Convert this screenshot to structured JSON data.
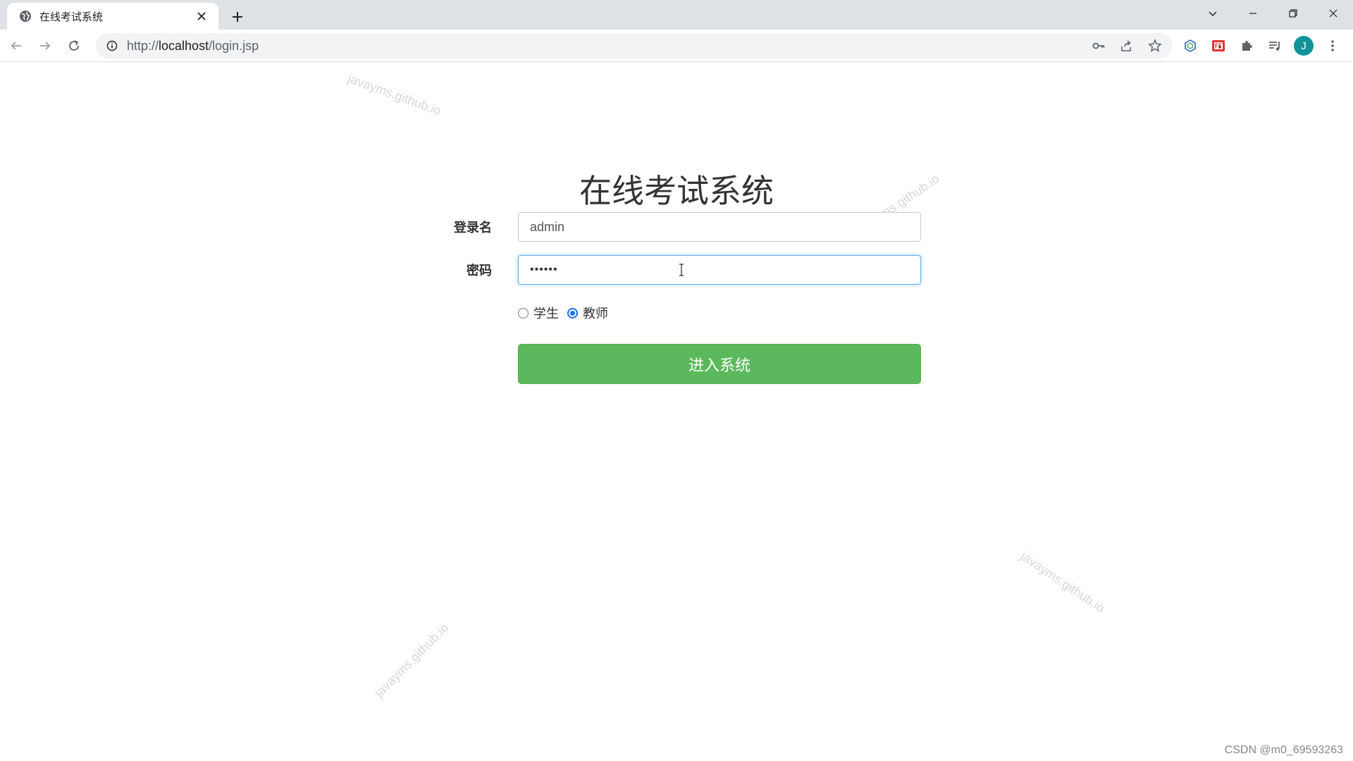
{
  "browser": {
    "tab_title": "在线考试系统",
    "url_scheme": "http://",
    "url_host": "localhost",
    "url_path": "/login.jsp",
    "avatar_letter": "J",
    "accent": "#1a73e8"
  },
  "page": {
    "watermark_text": "javayms.github.io",
    "title": "在线考试系统",
    "username_label": "登录名",
    "username_value": "admin",
    "password_label": "密码",
    "password_mask": "••••••",
    "roles": [
      {
        "label": "学生",
        "checked": false
      },
      {
        "label": "教师",
        "checked": true
      }
    ],
    "submit_label": "进入系统",
    "submit_color": "#5cb85c",
    "footer_credit": "CSDN @m0_69593263"
  }
}
